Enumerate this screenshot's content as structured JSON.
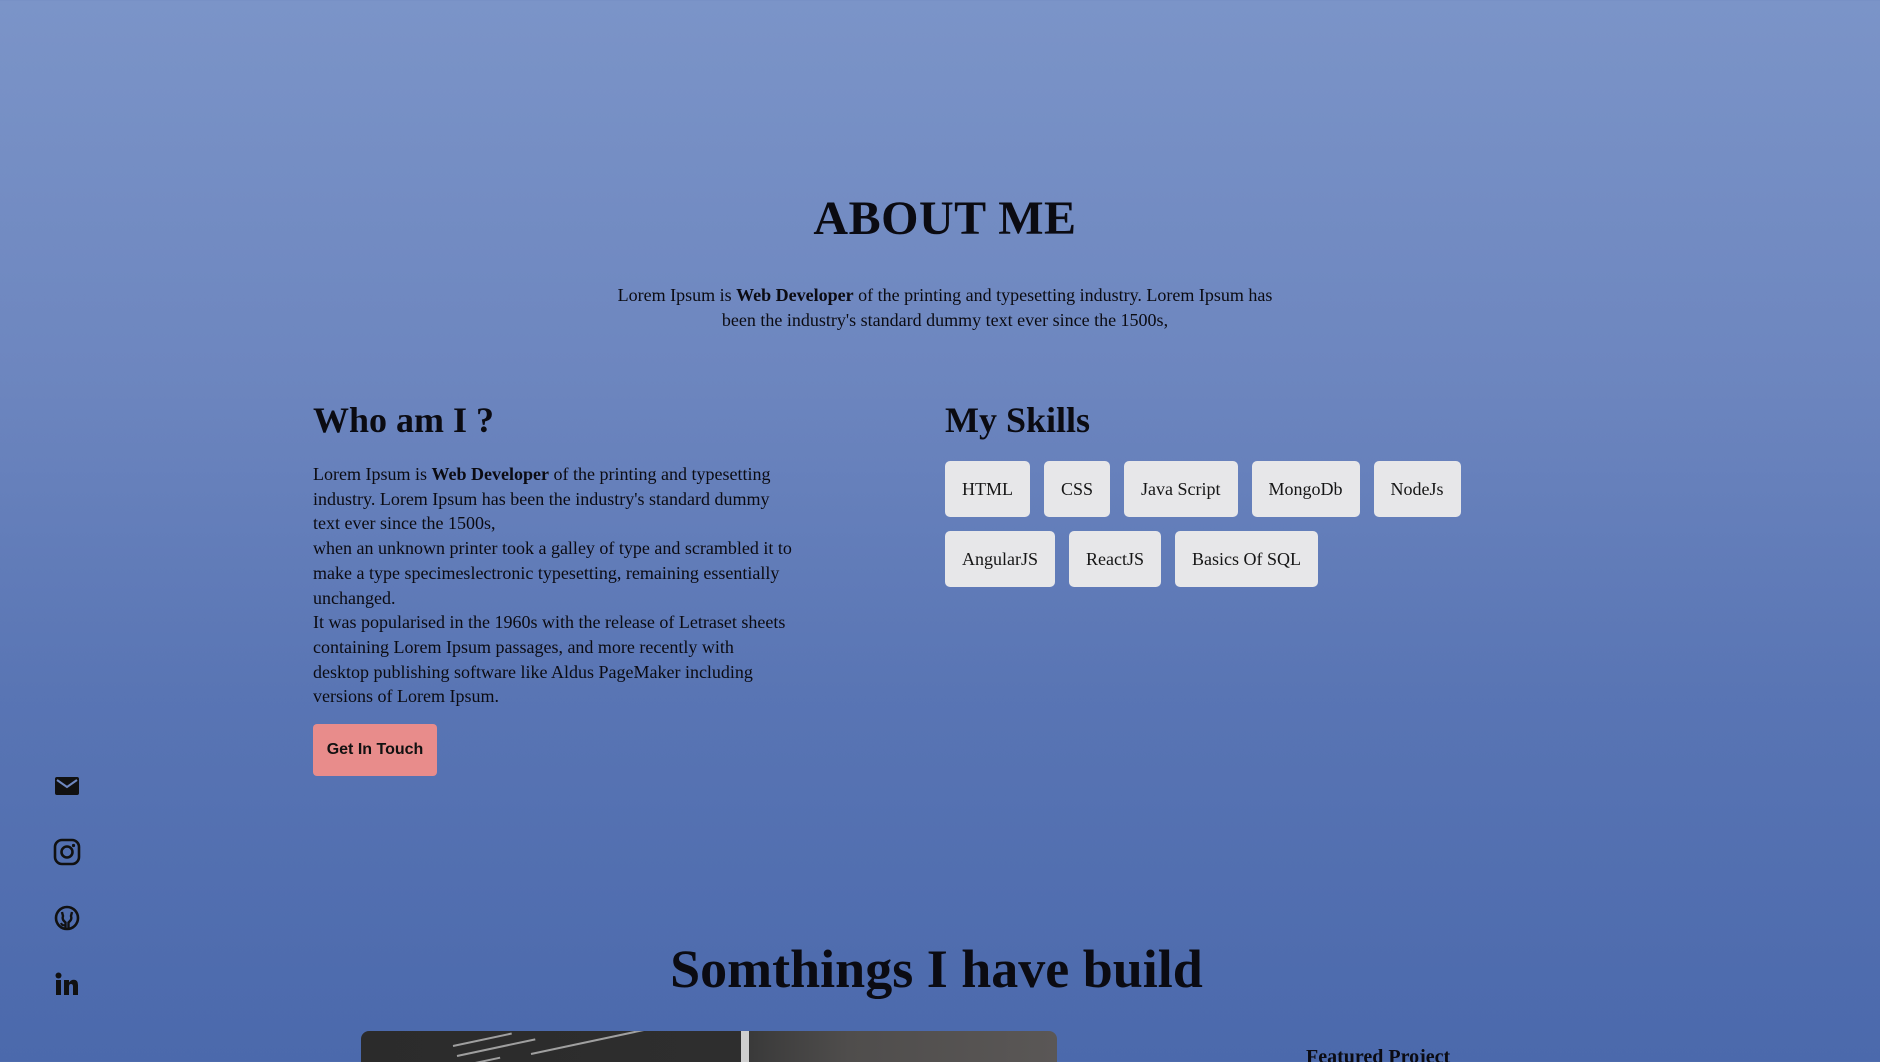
{
  "about": {
    "title": "ABOUT ME",
    "lead_prefix": "Lorem Ipsum is ",
    "lead_bold": "Web Developer",
    "lead_suffix": " of the printing and typesetting industry. Lorem Ipsum has been the industry's standard dummy text ever since the 1500s,"
  },
  "who": {
    "heading": "Who am I ?",
    "p1_prefix": "Lorem Ipsum is ",
    "p1_bold": "Web Developer",
    "p1_suffix": " of the printing and typesetting industry. Lorem Ipsum has been the industry's standard dummy text ever since the 1500s,",
    "p2": "when an unknown printer took a galley of type and scrambled it to make a type specimeslectronic typesetting, remaining essentially unchanged.",
    "p3": "It was popularised in the 1960s with the release of Letraset sheets containing Lorem Ipsum passages, and more recently with desktop publishing software like Aldus PageMaker including versions of Lorem Ipsum.",
    "cta_label": "Get In Touch"
  },
  "skills": {
    "heading": "My Skills",
    "items": [
      "HTML",
      "CSS",
      "Java Script",
      "MongoDb",
      "NodeJs",
      "AngularJS",
      "ReactJS",
      "Basics Of SQL"
    ]
  },
  "social": {
    "icons": [
      "mail-icon",
      "instagram-icon",
      "github-icon",
      "linkedin-icon"
    ]
  },
  "projects": {
    "heading": "Somthings I have build",
    "featured_label": "Featured Project"
  },
  "colors": {
    "background_top": "#7b94c8",
    "background_bottom": "#4b69ac",
    "cta_background": "#e88c8b",
    "skill_chip": "#e7e7e9"
  }
}
